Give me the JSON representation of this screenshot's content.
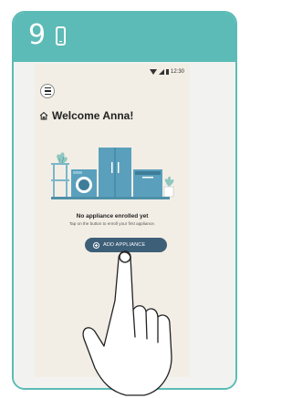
{
  "step": {
    "number": "9",
    "icon": "phone-icon"
  },
  "status_bar": {
    "time": "12:30",
    "icons": [
      "wifi-icon",
      "signal-icon",
      "battery-icon"
    ]
  },
  "header": {
    "menu_icon": "menu-icon",
    "home_icon": "home-icon",
    "greeting": "Welcome Anna!"
  },
  "empty_state": {
    "title": "No appliance enrolled yet",
    "subtitle": "Tap on the button to enroll your first appliance.",
    "button_label": "ADD APPLIANCE",
    "button_visible_label": "ADD APPLIANCE",
    "illustration": "appliances-illustration"
  },
  "gesture": {
    "icon": "tap-hand-icon"
  },
  "colors": {
    "accent": "#5cbbb6",
    "screen_bg": "#f3eee5",
    "button": "#3e5f78",
    "appliance": "#5aa0bd"
  }
}
